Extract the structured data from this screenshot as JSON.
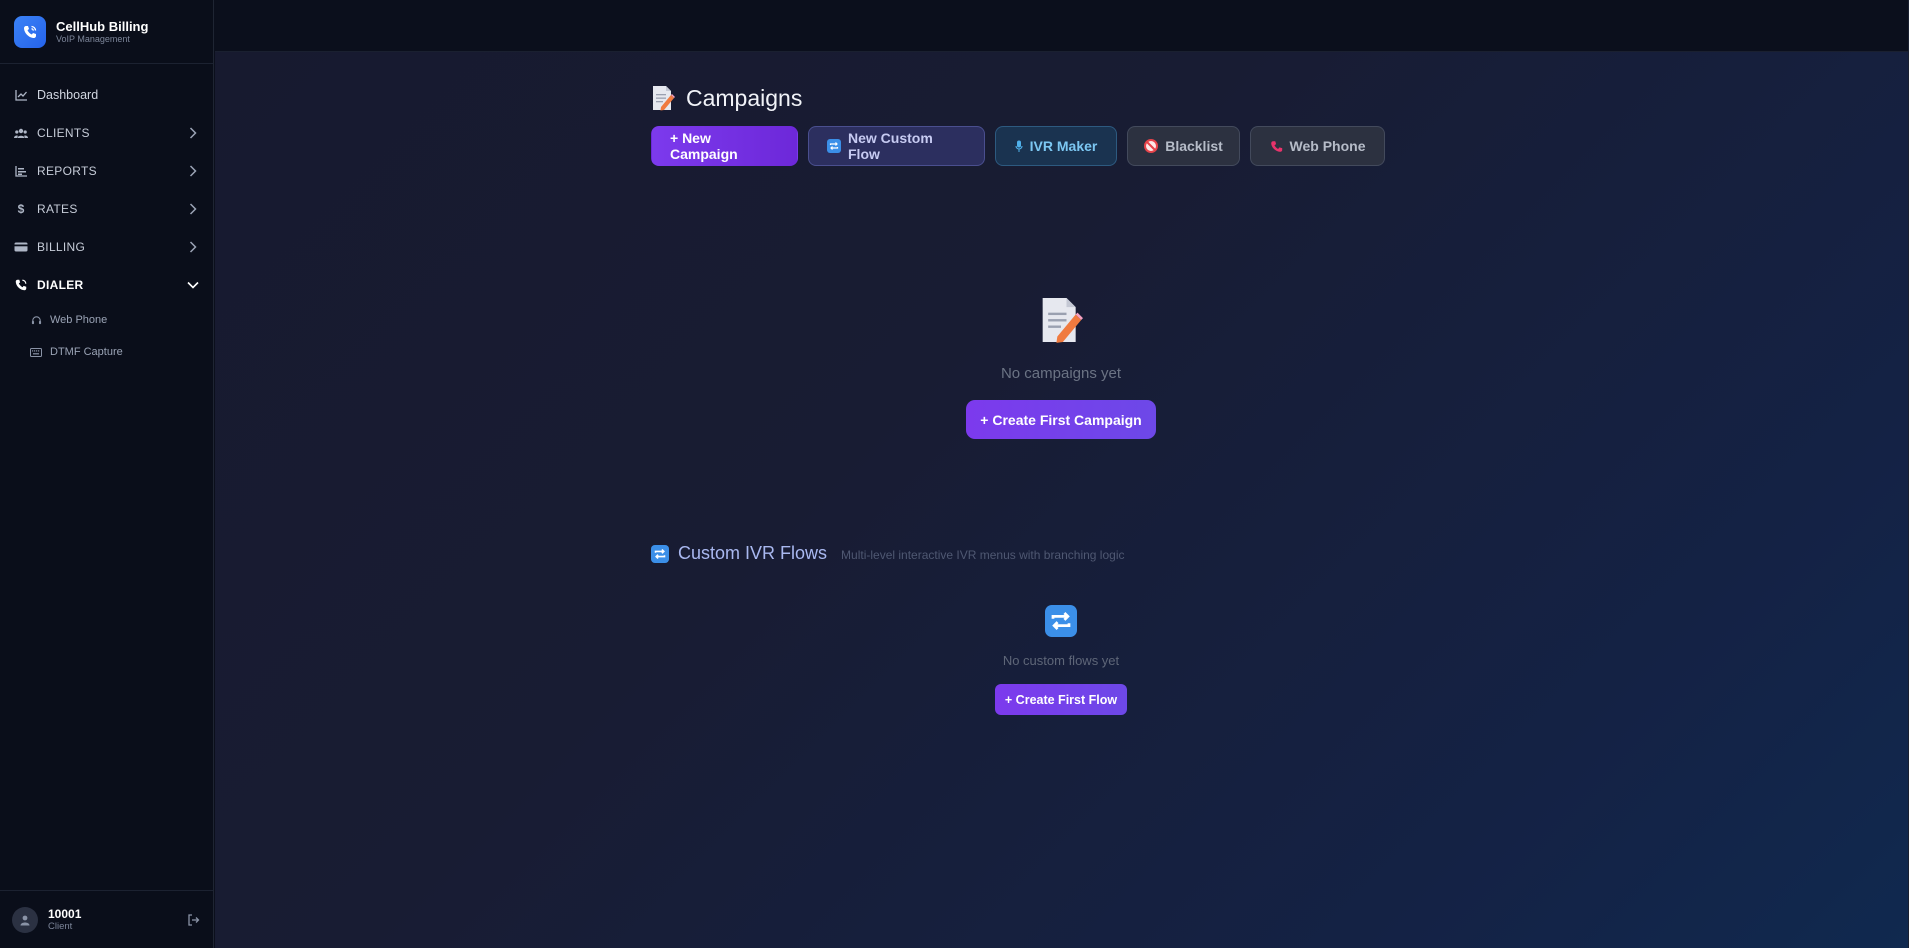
{
  "brand": {
    "name": "CellHub Billing",
    "subtitle": "VoIP Management"
  },
  "sidebar": {
    "items": [
      {
        "label": "Dashboard",
        "icon": "chart-line-icon"
      },
      {
        "label": "CLIENTS",
        "icon": "users-icon"
      },
      {
        "label": "REPORTS",
        "icon": "bar-chart-icon"
      },
      {
        "label": "RATES",
        "icon": "dollar-icon"
      },
      {
        "label": "BILLING",
        "icon": "credit-card-icon"
      },
      {
        "label": "DIALER",
        "icon": "phone-volume-icon"
      }
    ],
    "dialer_sub": [
      {
        "label": "Web Phone",
        "icon": "headset-icon"
      },
      {
        "label": "DTMF Capture",
        "icon": "keyboard-icon"
      }
    ]
  },
  "user": {
    "id": "10001",
    "role": "Client"
  },
  "page": {
    "title": "Campaigns"
  },
  "toolbar": {
    "new_campaign": "+ New Campaign",
    "new_custom_flow": "New Custom Flow",
    "ivr_maker": "IVR Maker",
    "blacklist": "Blacklist",
    "web_phone": "Web Phone"
  },
  "campaigns_empty": {
    "text": "No campaigns yet",
    "button": "+ Create First Campaign"
  },
  "custom_flows": {
    "title": "Custom IVR Flows",
    "description": "Multi-level interactive IVR menus with branching logic",
    "empty_text": "No custom flows yet",
    "button": "+ Create First Flow"
  },
  "colors": {
    "accent": "#7c3aed",
    "sidebar_bg": "#0a0e1a",
    "brand_blue": "#2563eb"
  }
}
